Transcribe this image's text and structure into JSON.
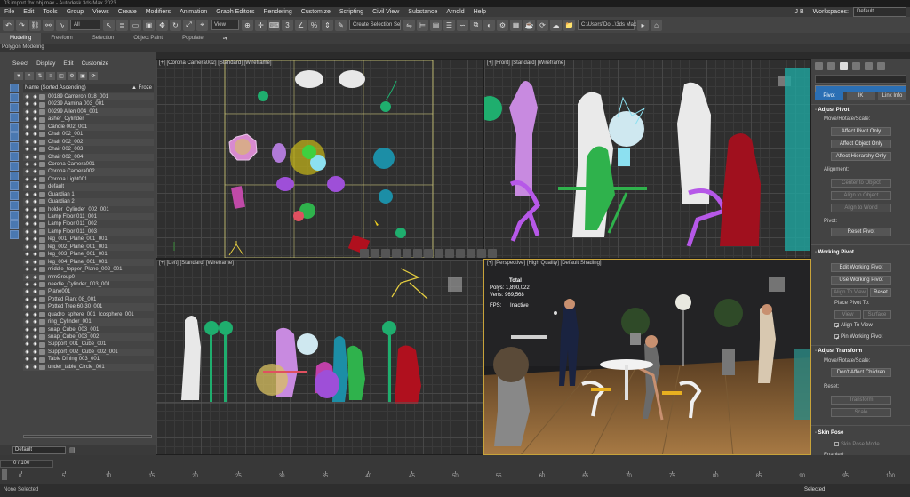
{
  "window": {
    "title": "03 import fbx obj.max - Autodesk 3ds Max 2023",
    "user": "J B",
    "workspace_label": "Workspaces:",
    "workspace_value": "Default"
  },
  "menu": [
    "File",
    "Edit",
    "Tools",
    "Group",
    "Views",
    "Create",
    "Modifiers",
    "Animation",
    "Graph Editors",
    "Rendering",
    "Customize",
    "Scripting",
    "Civil View",
    "Substance",
    "Arnold",
    "Help"
  ],
  "toolbar": {
    "filter": "All",
    "ref_coord": "View",
    "selection_set": "Create Selection Se",
    "path": "C:\\Users\\Do...\\3ds Max 202"
  },
  "ribbon": {
    "tabs": [
      "Modeling",
      "Freeform",
      "Selection",
      "Object Paint",
      "Populate"
    ],
    "active": "Modeling",
    "subtitle": "Polygon Modeling"
  },
  "explorer": {
    "tabs": [
      "Select",
      "Display",
      "Edit",
      "Customize"
    ],
    "column_header": "Name (Sorted Ascending)",
    "frozen_header": "▲ Froze",
    "items": [
      "00189 Cameron 018_001",
      "00239 Aamina 003_001",
      "00299 Allen 004_001",
      "asher_Cylinder",
      "Candle 002_001",
      "Chair 002_001",
      "Chair 002_002",
      "Chair 002_003",
      "Chair 002_004",
      "Corona Camera001",
      "Corona Camera002",
      "Corona Light001",
      "default",
      "Guardian 1",
      "Guardian 2",
      "holder_Cylinder_002_001",
      "Lamp Floor 011_001",
      "Lamp Floor 011_002",
      "Lamp Floor 011_003",
      "leg_001_Plane_001_001",
      "leg_002_Plane_001_001",
      "leg_003_Plane_001_001",
      "leg_004_Plane_001_001",
      "middle_topper_Plane_002_001",
      "mmGroup0",
      "needle_Cylinder_003_001",
      "Plane001",
      "Potted Plant 08_001",
      "Potted Tree 60-30_001",
      "quadro_sphere_001_Icosphere_001",
      "ring_Cylinder_001",
      "snap_Cube_003_001",
      "snap_Cube_003_002",
      "Support_001_Cube_001",
      "Support_002_Cube_002_001",
      "Table Dining 003_001",
      "under_table_Circle_001"
    ],
    "layer": "Default"
  },
  "viewports": {
    "top": "[+] [Corona Camera002] [Standard] [Wireframe]",
    "front": "[+] [Front] [Standard] [Wireframe]",
    "left": "[+] [Left] [Standard] [Wireframe]",
    "persp": "[+] [Perspective] [High Quality] [Default Shading]"
  },
  "stats": {
    "total": "Total",
    "polys_label": "Polys:",
    "polys": "1,890,022",
    "verts_label": "Verts:",
    "verts": "969,568",
    "fps_label": "FPS:",
    "fps": "Inactive"
  },
  "command_panel": {
    "tabs": [
      "Pivot",
      "IK",
      "Link Info"
    ],
    "active_tab": "Pivot",
    "adjust_pivot": {
      "title": "Adjust Pivot",
      "move_label": "Move/Rotate/Scale:",
      "buttons": [
        "Affect Pivot Only",
        "Affect Object Only",
        "Affect Hierarchy Only"
      ],
      "alignment_label": "Alignment:",
      "align_buttons": [
        "Center to Object",
        "Align to Object",
        "Align to World"
      ],
      "pivot_label": "Pivot:",
      "reset": "Reset Pivot"
    },
    "working_pivot": {
      "title": "Working Pivot",
      "edit": "Edit Working Pivot",
      "use": "Use Working Pivot",
      "align_view": "Align To View",
      "reset": "Reset",
      "place_label": "Place Pivot To:",
      "view": "View",
      "surface": "Surface",
      "align_chk": "Align To View",
      "pin_chk": "Pin Working Pivot"
    },
    "adjust_transform": {
      "title": "Adjust Transform",
      "move_label": "Move/Rotate/Scale:",
      "dont_affect": "Don't Affect Children",
      "reset_label": "Reset:",
      "transform": "Transform",
      "scale": "Scale"
    },
    "skin_pose": {
      "title": "Skin Pose",
      "mode": "Skin Pose Mode",
      "enabled": "Enabled:"
    }
  },
  "timeline": {
    "frame_counter": "0 / 100",
    "ticks": [
      "0",
      "5",
      "10",
      "15",
      "20",
      "25",
      "30",
      "35",
      "40",
      "45",
      "50",
      "55",
      "60",
      "65",
      "70",
      "75",
      "80",
      "85",
      "90",
      "95",
      "100"
    ]
  },
  "status": {
    "text": "None Selected",
    "selected_label": "Selected"
  },
  "colors": {
    "accent": "#2b6fb4",
    "viewport_bg": "#2f2f2f",
    "active_border": "#c8a33a"
  }
}
